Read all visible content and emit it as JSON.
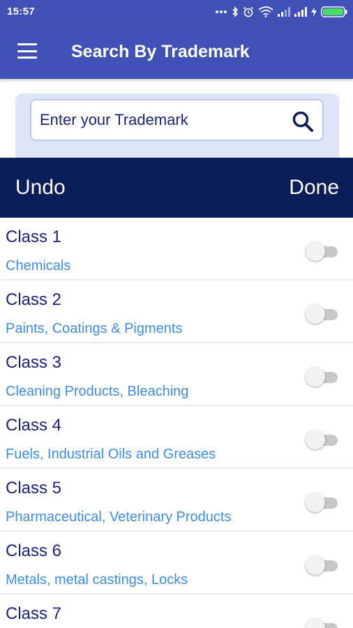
{
  "status_bar": {
    "time": "15:57",
    "icons": [
      "more-dots-icon",
      "bluetooth-icon",
      "alarm-icon",
      "wifi-icon",
      "signal-icon",
      "signal-icon",
      "charging-icon",
      "battery-icon"
    ],
    "battery_color": "#4cd964"
  },
  "app_bar": {
    "title": "Search By Trademark",
    "background": "#3f51b5"
  },
  "search": {
    "placeholder": "Enter your Trademark",
    "value": ""
  },
  "actions": {
    "undo_label": "Undo",
    "done_label": "Done",
    "background": "#0b1e57"
  },
  "classes": [
    {
      "title": "Class 1",
      "description": "Chemicals",
      "enabled": false
    },
    {
      "title": "Class 2",
      "description": "Paints, Coatings & Pigments",
      "enabled": false
    },
    {
      "title": "Class 3",
      "description": "Cleaning Products, Bleaching",
      "enabled": false
    },
    {
      "title": "Class 4",
      "description": "Fuels, Industrial Oils and Greases",
      "enabled": false
    },
    {
      "title": "Class 5",
      "description": "Pharmaceutical, Veterinary Products",
      "enabled": false
    },
    {
      "title": "Class 6",
      "description": "Metals, metal castings, Locks",
      "enabled": false
    },
    {
      "title": "Class 7",
      "description": "",
      "enabled": false
    }
  ]
}
